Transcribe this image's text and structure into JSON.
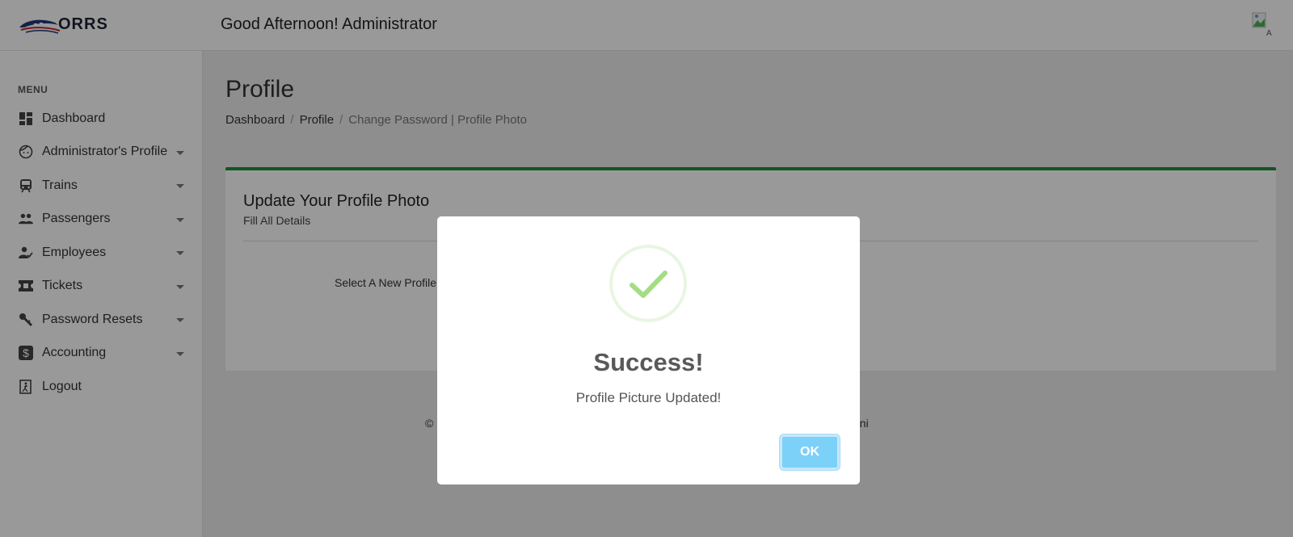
{
  "header": {
    "logo_text": "ORRS",
    "greeting": "Good Afternoon! Administrator",
    "avatar_alt": "A"
  },
  "sidebar": {
    "heading": "MENU",
    "items": [
      {
        "label": "Dashboard",
        "icon": "dashboard-icon",
        "has_submenu": false
      },
      {
        "label": "Administrator's Profile",
        "icon": "face-icon",
        "has_submenu": true
      },
      {
        "label": "Trains",
        "icon": "train-icon",
        "has_submenu": true
      },
      {
        "label": "Passengers",
        "icon": "people-icon",
        "has_submenu": true
      },
      {
        "label": "Employees",
        "icon": "employee-icon",
        "has_submenu": true
      },
      {
        "label": "Tickets",
        "icon": "ticket-icon",
        "has_submenu": true
      },
      {
        "label": "Password Resets",
        "icon": "key-icon",
        "has_submenu": true
      },
      {
        "label": "Accounting",
        "icon": "dollar-icon",
        "has_submenu": true
      },
      {
        "label": "Logout",
        "icon": "logout-icon",
        "has_submenu": false
      }
    ]
  },
  "main": {
    "title": "Profile",
    "breadcrumb": [
      "Dashboard",
      "Profile",
      "Change Password | Profile Photo"
    ],
    "card": {
      "title": "Update Your Profile Photo",
      "subtitle": "Fill All Details",
      "field_label": "Select A New Profile"
    },
    "footer_left": "©",
    "footer_right": "ani"
  },
  "modal": {
    "title": "Success!",
    "text": "Profile Picture Updated!",
    "ok_label": "OK"
  },
  "colors": {
    "accent_green": "#1e8e3e",
    "success_check": "#a5dc86",
    "ok_button": "#7cd1f9"
  }
}
